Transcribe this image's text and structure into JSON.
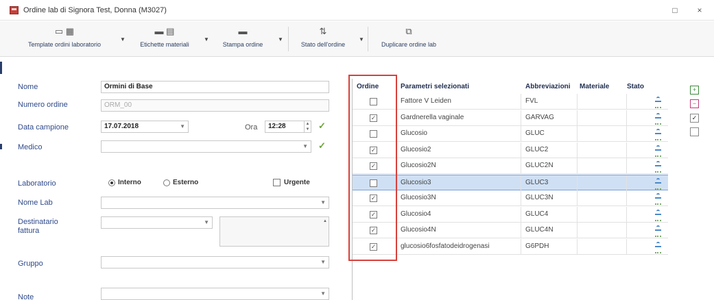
{
  "window": {
    "title": "Ordine lab di Signora Test, Donna (M3027)",
    "minimize": "□",
    "close": "×"
  },
  "toolbar": {
    "items": [
      {
        "label": "Template ordini laboratorio",
        "icon": "template-icon"
      },
      {
        "label": "Etichette materiali",
        "icon": "barcode-label-icon"
      },
      {
        "label": "Stampa ordine",
        "icon": "printer-icon"
      },
      {
        "label": "Stato dell'ordine",
        "icon": "order-status-icon"
      },
      {
        "label": "Duplicare ordine lab",
        "icon": "duplicate-icon"
      }
    ]
  },
  "form": {
    "nome": {
      "label": "Nome",
      "value": "Ormini di Base"
    },
    "numero_ordine": {
      "label": "Numero ordine",
      "value": "ORM_00"
    },
    "data_campione": {
      "label": "Data campione",
      "value": "17.07.2018"
    },
    "ora": {
      "label": "Ora",
      "value": "12:28"
    },
    "medico": {
      "label": "Medico",
      "value": ""
    },
    "laboratorio": {
      "label": "Laboratorio",
      "options": [
        "Interno",
        "Esterno"
      ],
      "selected": "Interno",
      "urgente_label": "Urgente"
    },
    "nome_lab": {
      "label": "Nome Lab",
      "value": ""
    },
    "destinatario": {
      "label_line1": "Destinatario",
      "label_line2": "fattura",
      "value": ""
    },
    "gruppo": {
      "label": "Gruppo",
      "value": ""
    },
    "note": {
      "label": "Note",
      "value": ""
    }
  },
  "grid": {
    "headers": {
      "ordine": "Ordine",
      "parametri": "Parametri selezionati",
      "abbreviazione": "Abbreviazioni",
      "materiale": "Materiale",
      "stato": "Stato"
    },
    "rows": [
      {
        "checked": false,
        "param": "Fattore V Leiden",
        "abbr": "FVL",
        "selected": false
      },
      {
        "checked": true,
        "param": "Gardnerella vaginale",
        "abbr": "GARVAG",
        "selected": false
      },
      {
        "checked": false,
        "param": "Glucosio",
        "abbr": "GLUC",
        "selected": false
      },
      {
        "checked": true,
        "param": "Glucosio2",
        "abbr": "GLUC2",
        "selected": false
      },
      {
        "checked": true,
        "param": "Glucosio2N",
        "abbr": "GLUC2N",
        "selected": false
      },
      {
        "checked": false,
        "param": "Glucosio3",
        "abbr": "GLUC3",
        "selected": true
      },
      {
        "checked": true,
        "param": "Glucosio3N",
        "abbr": "GLUC3N",
        "selected": false
      },
      {
        "checked": true,
        "param": "Glucosio4",
        "abbr": "GLUC4",
        "selected": false
      },
      {
        "checked": true,
        "param": "Glucosio4N",
        "abbr": "GLUC4N",
        "selected": false
      },
      {
        "checked": true,
        "param": "glucosio6fosfatodeidrogenasi",
        "abbr": "G6PDH",
        "selected": false
      }
    ]
  },
  "side_icons": [
    "add-param-icon",
    "remove-param-icon",
    "check-all-icon",
    "uncheck-all-icon"
  ]
}
